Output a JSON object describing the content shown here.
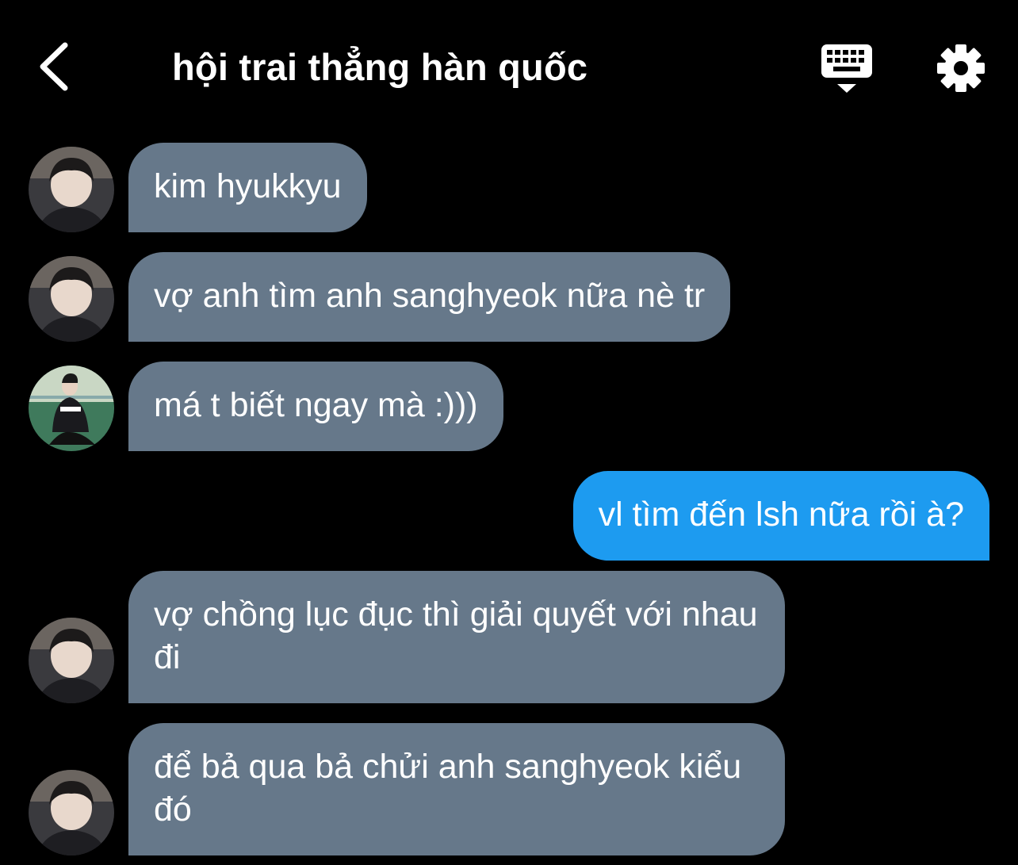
{
  "header": {
    "title": "hội trai thẳng hàn quốc",
    "back_icon": "chevron-left-icon",
    "keyboard_icon": "keyboard-icon",
    "settings_icon": "gear-icon"
  },
  "colors": {
    "background": "#000000",
    "incoming_bubble": "#66788a",
    "outgoing_bubble": "#1d9bf0",
    "text": "#ffffff"
  },
  "messages": [
    {
      "direction": "incoming",
      "sender_avatar": "avatar-user-a",
      "text": "kim hyukkyu"
    },
    {
      "direction": "incoming",
      "sender_avatar": "avatar-user-a",
      "text": "vợ anh tìm anh sanghyeok nữa nè tr"
    },
    {
      "direction": "incoming",
      "sender_avatar": "avatar-user-b",
      "text": "má t biết ngay mà :)))"
    },
    {
      "direction": "outgoing",
      "text": "vl tìm đến lsh nữa rồi à?"
    },
    {
      "direction": "incoming",
      "sender_avatar": "avatar-user-a",
      "text": "vợ chồng lục đục thì giải quyết với nhau đi"
    },
    {
      "direction": "incoming",
      "sender_avatar": "avatar-user-a",
      "text": "để bả qua bả chửi anh sanghyeok kiểu đó"
    }
  ]
}
